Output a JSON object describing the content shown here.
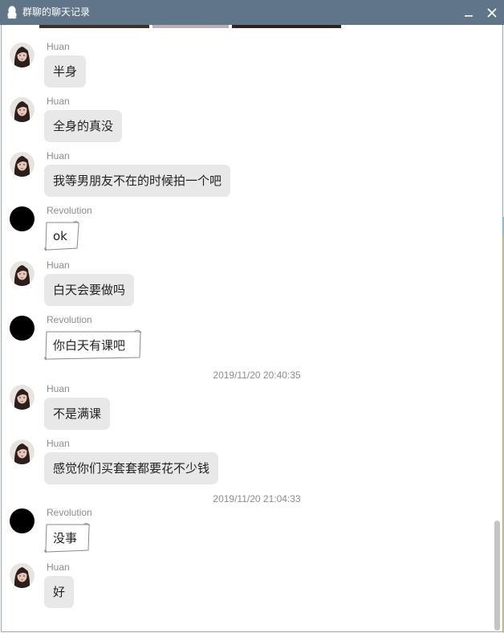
{
  "window": {
    "title": "群聊的聊天记录",
    "minimize_icon": "minimize-icon",
    "close_icon": "close-icon",
    "app_icon": "qq-penguin-icon"
  },
  "colors": {
    "titlebar": "#607587",
    "bubble_fill": "#e8e8e8",
    "scroll_bubble_stroke": "#8a8a8a",
    "sender_text": "#8c8c8c",
    "scrollbar": "#c4c4c4"
  },
  "messages": [
    {
      "sender": "Huan",
      "text": "半身",
      "style": "bubble"
    },
    {
      "sender": "Huan",
      "text": "全身的真没",
      "style": "bubble"
    },
    {
      "sender": "Huan",
      "text": "我等男朋友不在的时候拍一个吧",
      "style": "bubble"
    },
    {
      "sender": "Revolution",
      "text": "ok",
      "style": "scroll"
    },
    {
      "sender": "Huan",
      "text": "白天会要做吗",
      "style": "bubble"
    },
    {
      "sender": "Revolution",
      "text": "你白天有课吧",
      "style": "scroll"
    },
    {
      "timestamp": "2019/11/20 20:40:35"
    },
    {
      "sender": "Huan",
      "text": "不是满课",
      "style": "bubble"
    },
    {
      "sender": "Huan",
      "text": "感觉你们买套套都要花不少钱",
      "style": "bubble"
    },
    {
      "timestamp": "2019/11/20 21:04:33"
    },
    {
      "sender": "Revolution",
      "text": "没事",
      "style": "scroll"
    },
    {
      "sender": "Huan",
      "text": "好",
      "style": "bubble"
    }
  ]
}
